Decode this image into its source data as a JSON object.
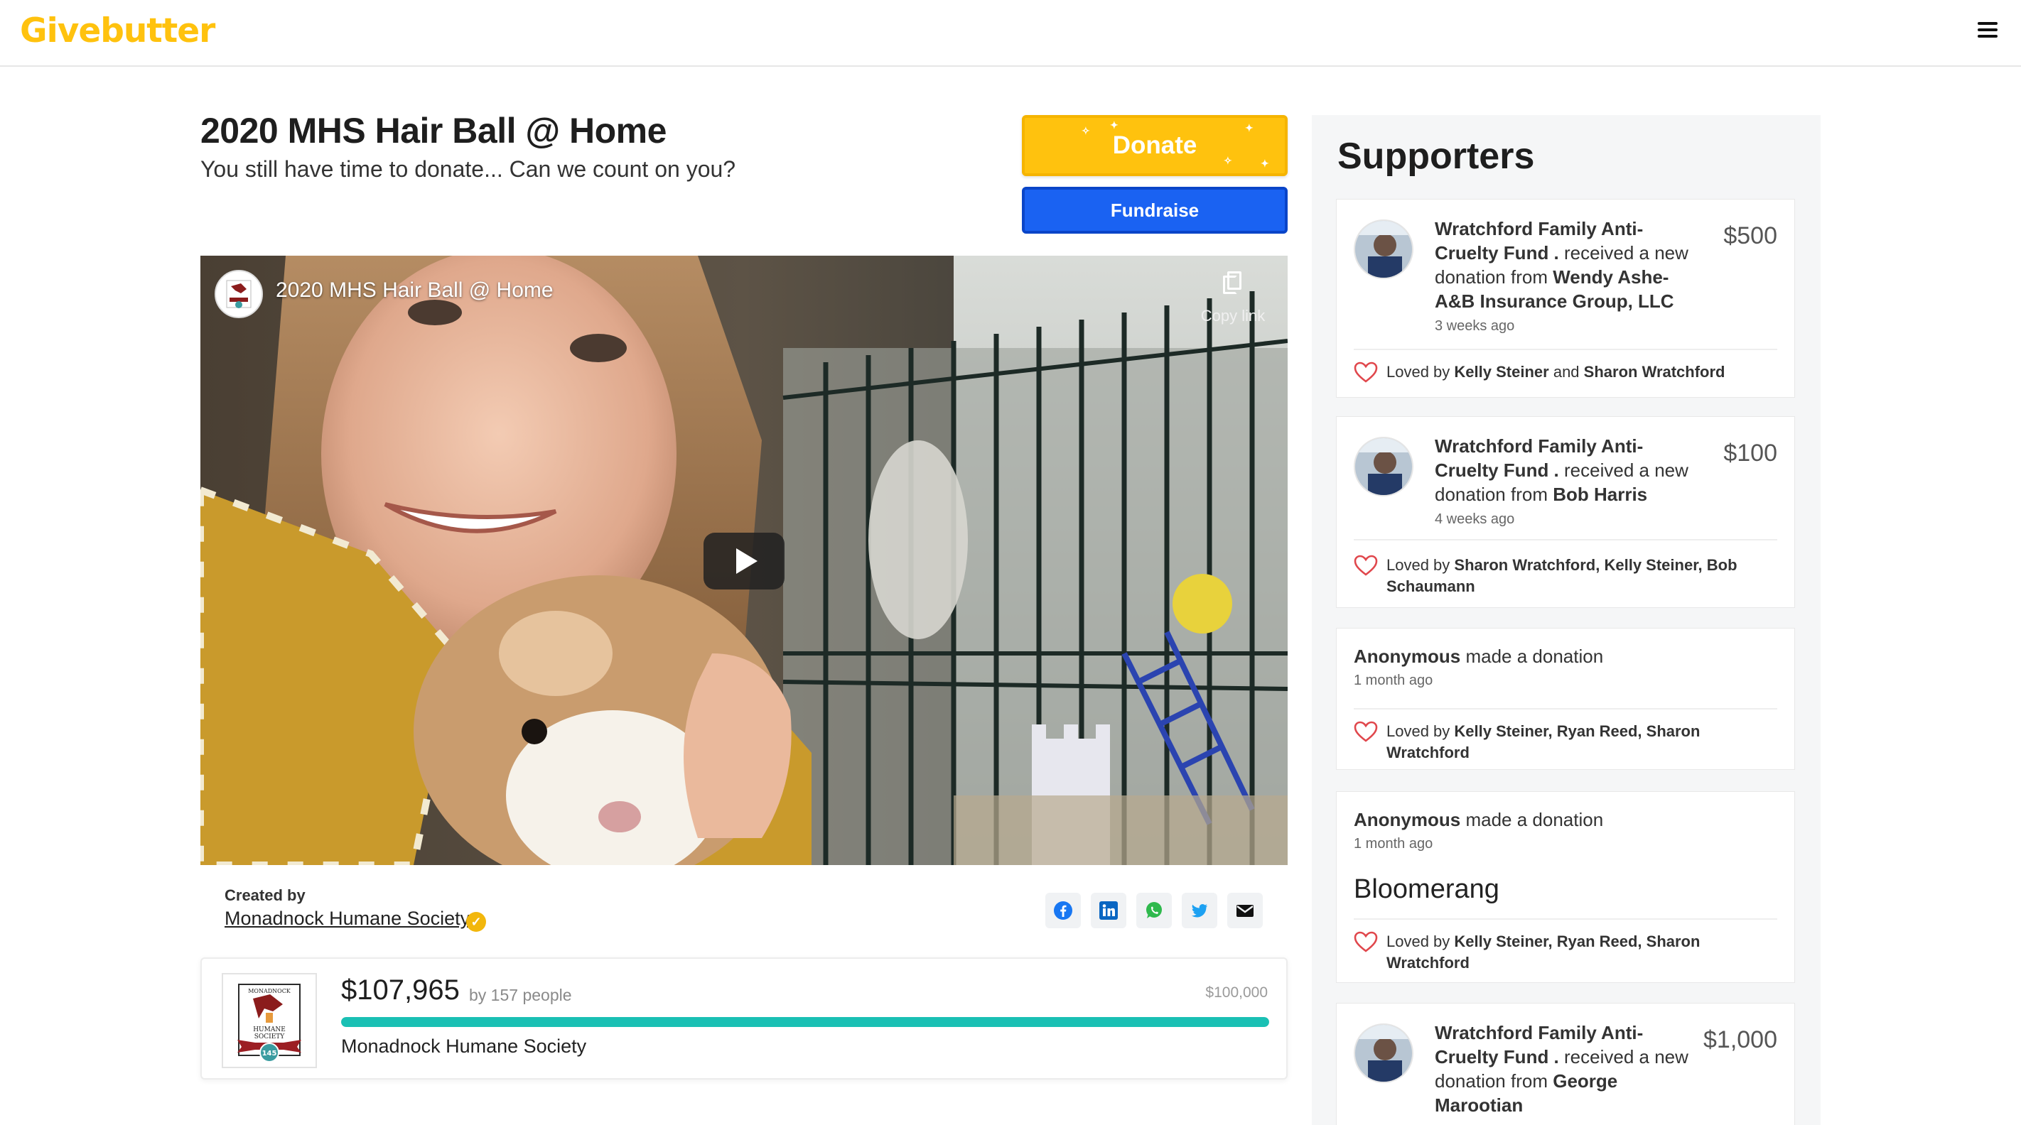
{
  "header": {
    "logo": "Givebutter",
    "menu_icon": "hamburger-menu-icon"
  },
  "campaign": {
    "title": "2020 MHS Hair Ball @ Home",
    "subtitle": "You still have time to donate... Can we count on you?",
    "donate_label": "Donate",
    "fundraise_label": "Fundraise"
  },
  "video": {
    "title": "2020 MHS Hair Ball @ Home",
    "copy_link": "Copy link",
    "play_icon": "play-icon"
  },
  "creator": {
    "label": "Created by",
    "name": "Monadnock Humane Society"
  },
  "share": [
    "facebook-icon",
    "linkedin-icon",
    "whatsapp-icon",
    "twitter-icon",
    "email-icon"
  ],
  "progress": {
    "raised": "$107,965",
    "by": "by 157 people",
    "goal": "$100,000",
    "percent": 100,
    "org": "Monadnock Humane Society",
    "logo_text": {
      "top": "MONADNOCK",
      "mid1": "HUMANE",
      "mid2": "SOCIETY",
      "num": "145"
    }
  },
  "supporters": {
    "heading": "Supporters",
    "cards": [
      {
        "recipient": "Wratchford Family Anti-Cruelty Fund .",
        "received": "received a new donation from",
        "donor": "Wendy Ashe- A&B Insurance Group, LLC",
        "time": "3 weeks ago",
        "amount": "$500",
        "loved_prefix": "Loved by",
        "loved_a": "Kelly Steiner",
        "loved_join": "and",
        "loved_b": "Sharon Wratchford"
      },
      {
        "recipient": "Wratchford Family Anti-Cruelty Fund .",
        "received": "received a new donation from",
        "donor": "Bob Harris",
        "time": "4 weeks ago",
        "amount": "$100",
        "loved_prefix": "Loved by",
        "loved_names": "Sharon Wratchford, Kelly Steiner, Bob Schaumann"
      },
      {
        "donor": "Anonymous",
        "action": "made a donation",
        "time": "1 month ago",
        "loved_prefix": "Loved by",
        "loved_names": "Kelly Steiner, Ryan Reed, Sharon Wratchford"
      },
      {
        "donor": "Anonymous",
        "action": "made a donation",
        "time": "1 month ago",
        "message": "Bloomerang",
        "loved_prefix": "Loved by",
        "loved_names": "Kelly Steiner, Ryan Reed, Sharon Wratchford"
      },
      {
        "recipient": "Wratchford Family Anti-Cruelty Fund .",
        "received": "received a new donation from",
        "donor": "George Marootian",
        "amount": "$1,000"
      }
    ]
  },
  "colors": {
    "brand": "#FFC20E",
    "fundraise": "#1a62f2",
    "progress": "#1ac0b4",
    "heart": "#e0474c"
  }
}
